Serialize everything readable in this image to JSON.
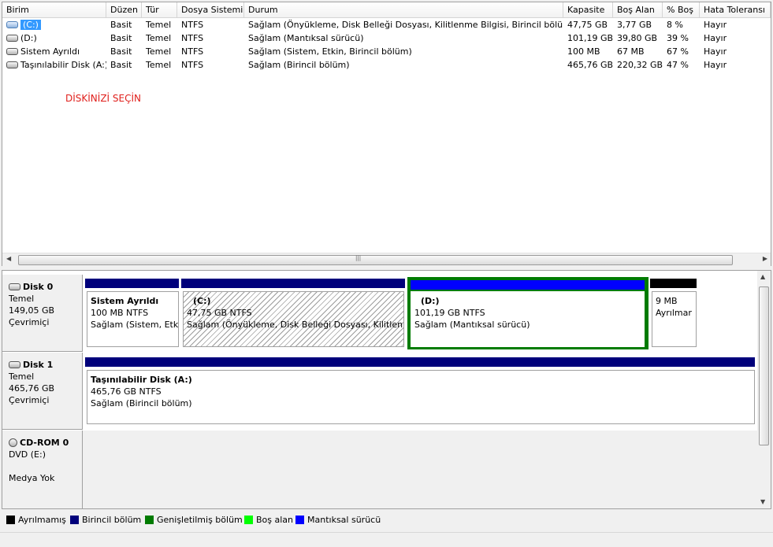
{
  "volume_list": {
    "columns": [
      "Birim",
      "Düzen",
      "Tür",
      "Dosya Sistemi",
      "Durum",
      "Kapasite",
      "Boş Alan",
      "% Boş",
      "Hata Toleransı"
    ],
    "rows": [
      {
        "name": "(C:)",
        "layout": "Basit",
        "type": "Temel",
        "fs": "NTFS",
        "status": "Sağlam (Önyükleme, Disk Belleği Dosyası, Kilitlenme Bilgisi, Birincil bölüm)",
        "capacity": "47,75 GB",
        "free": "3,77 GB",
        "pct": "8 %",
        "fault": "Hayır"
      },
      {
        "name": "(D:)",
        "layout": "Basit",
        "type": "Temel",
        "fs": "NTFS",
        "status": "Sağlam (Mantıksal sürücü)",
        "capacity": "101,19 GB",
        "free": "39,80 GB",
        "pct": "39 %",
        "fault": "Hayır"
      },
      {
        "name": "Sistem Ayrıldı",
        "layout": "Basit",
        "type": "Temel",
        "fs": "NTFS",
        "status": "Sağlam (Sistem, Etkin, Birincil bölüm)",
        "capacity": "100 MB",
        "free": "67 MB",
        "pct": "67 %",
        "fault": "Hayır"
      },
      {
        "name": "Taşınılabilir Disk (A:)",
        "layout": "Basit",
        "type": "Temel",
        "fs": "NTFS",
        "status": "Sağlam (Birincil bölüm)",
        "capacity": "465,76 GB",
        "free": "220,32 GB",
        "pct": "47 %",
        "fault": "Hayır"
      }
    ],
    "annotation": "DİSKİNİZİ SEÇİN"
  },
  "disks": [
    {
      "name": "Disk 0",
      "kind": "Temel",
      "size": "149,05 GB",
      "state": "Çevrimiçi",
      "partitions": [
        {
          "title": "Sistem Ayrıldı",
          "size": "100 MB NTFS",
          "status": "Sağlam (Sistem, Etki"
        },
        {
          "title": "(C:)",
          "size": "47,75 GB NTFS",
          "status": "Sağlam (Önyükleme, Disk Belleği Dosyası, Kilitlenme"
        },
        {
          "title": "(D:)",
          "size": "101,19 GB NTFS",
          "status": "Sağlam (Mantıksal sürücü)"
        },
        {
          "title": "",
          "size": "9 MB",
          "status": "Ayrılmar"
        }
      ]
    },
    {
      "name": "Disk 1",
      "kind": "Temel",
      "size": "465,76 GB",
      "state": "Çevrimiçi",
      "partitions": [
        {
          "title": "Taşınılabilir Disk  (A:)",
          "size": "465,76 GB NTFS",
          "status": "Sağlam (Birincil bölüm)"
        }
      ]
    },
    {
      "name": "CD-ROM 0",
      "kind": "DVD (E:)",
      "size": "",
      "state": "Medya Yok",
      "partitions": []
    }
  ],
  "legend": [
    {
      "label": "Ayrılmamış",
      "color": "#000000"
    },
    {
      "label": "Birincil bölüm",
      "color": "#00007b"
    },
    {
      "label": "Genişletilmiş bölüm",
      "color": "#007b00"
    },
    {
      "label": "Boş alan",
      "color": "#00ff00"
    },
    {
      "label": "Mantıksal sürücü",
      "color": "#0000ff"
    }
  ],
  "colors": {
    "primary": "#00007b",
    "logical": "#0000ff",
    "unallocated": "#000000",
    "extended": "#007b00",
    "selection": "#3399ff",
    "annotation": "#e0201c"
  },
  "icons": {
    "drive": "hard-drive-icon",
    "cdrom": "cdrom-icon"
  }
}
